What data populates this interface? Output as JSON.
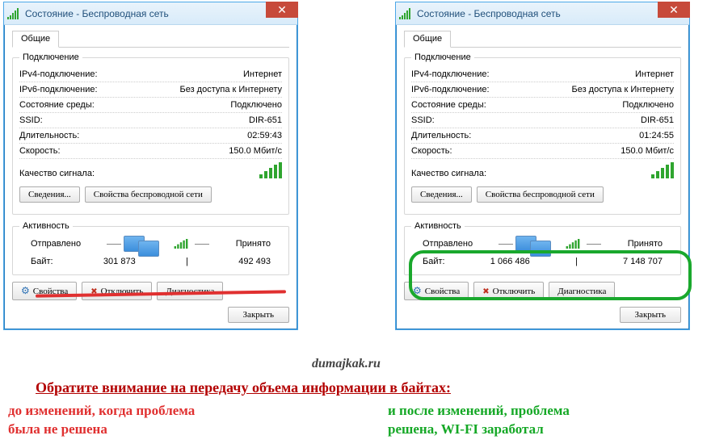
{
  "left": {
    "title": "Состояние - Беспроводная сеть",
    "tab": "Общие",
    "conn_legend": "Подключение",
    "ipv4_k": "IPv4-подключение:",
    "ipv4_v": "Интернет",
    "ipv6_k": "IPv6-подключение:",
    "ipv6_v": "Без доступа к Интернету",
    "media_k": "Состояние среды:",
    "media_v": "Подключено",
    "ssid_k": "SSID:",
    "ssid_v": "DIR-651",
    "dur_k": "Длительность:",
    "dur_v": "02:59:43",
    "spd_k": "Скорость:",
    "spd_v": "150.0 Мбит/с",
    "qual_k": "Качество сигнала:",
    "btn_details": "Сведения...",
    "btn_wprops": "Свойства беспроводной сети",
    "act_legend": "Активность",
    "sent": "Отправлено",
    "recv": "Принято",
    "bytes_k": "Байт:",
    "bytes_sent": "301 873",
    "bytes_recv": "492 493",
    "btn_props": "Свойства",
    "btn_disc": "Отключить",
    "btn_diag": "Диагностика",
    "btn_close": "Закрыть"
  },
  "right": {
    "title": "Состояние - Беспроводная сеть",
    "tab": "Общие",
    "conn_legend": "Подключение",
    "ipv4_k": "IPv4-подключение:",
    "ipv4_v": "Интернет",
    "ipv6_k": "IPv6-подключение:",
    "ipv6_v": "Без доступа к Интернету",
    "media_k": "Состояние среды:",
    "media_v": "Подключено",
    "ssid_k": "SSID:",
    "ssid_v": "DIR-651",
    "dur_k": "Длительность:",
    "dur_v": "01:24:55",
    "spd_k": "Скорость:",
    "spd_v": "150.0 Мбит/с",
    "qual_k": "Качество сигнала:",
    "btn_details": "Сведения...",
    "btn_wprops": "Свойства беспроводной сети",
    "act_legend": "Активность",
    "sent": "Отправлено",
    "recv": "Принято",
    "bytes_k": "Байт:",
    "bytes_sent": "1 066 486",
    "bytes_recv": "7 148 707",
    "btn_props": "Свойства",
    "btn_disc": "Отключить",
    "btn_diag": "Диагностика",
    "btn_close": "Закрыть"
  },
  "watermark": "dumajkak.ru",
  "captions": {
    "head": "Обратите внимание на передачу объема информации в байтах:",
    "left": "до изменений, когда проблема\nбыла не решена",
    "right": "и после изменений, проблема\nрешена, WI-FI заработал"
  }
}
